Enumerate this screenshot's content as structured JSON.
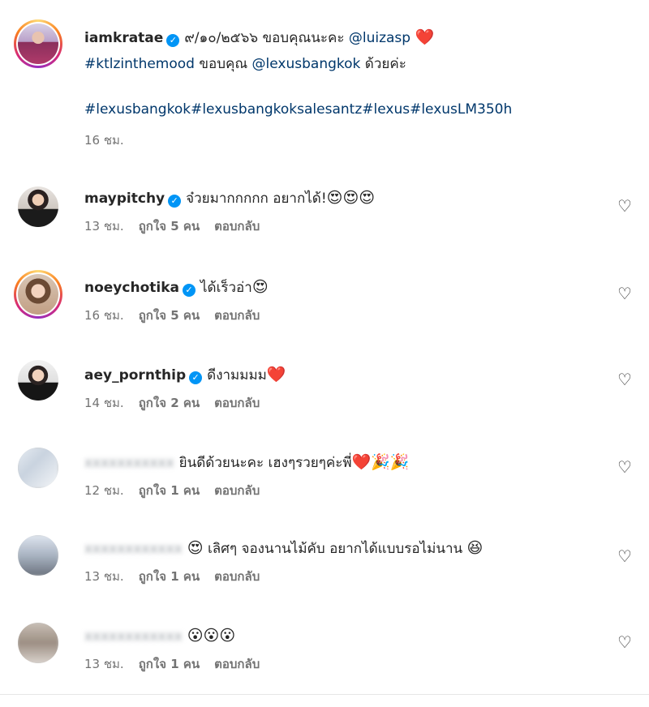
{
  "post": {
    "username": "iamkratae",
    "text_1": "๙/๑๐/๒๕๖๖ ขอบคุณนะคะ ",
    "mention_1": "@luizasp",
    "emoji_1": "❤️",
    "hashtag_1": "#ktlzinthemood",
    "text_2": " ขอบคุณ ",
    "mention_2": "@lexusbangkok",
    "text_3": " ด้วยค่ะ",
    "hashtags": "#lexusbangkok#lexusbangkoksalesantz#lexus#lexusLM350h",
    "time": "16 ชม."
  },
  "comments": [
    {
      "username": "maypitchy",
      "verified": true,
      "text": "จ๋วยมากกกกก อยากได้!",
      "emoji": "😍😍😍",
      "time": "13 ชม.",
      "likes": "ถูกใจ 5 คน",
      "reply": "ตอบกลับ"
    },
    {
      "username": "noeychotika",
      "verified": true,
      "text": "ได้เร็วอ่า",
      "emoji": "😍",
      "time": "16 ชม.",
      "likes": "ถูกใจ 5 คน",
      "reply": "ตอบกลับ"
    },
    {
      "username": "aey_pornthip",
      "verified": true,
      "text": "ดีงามมมม",
      "emoji": "❤️",
      "time": "14 ชม.",
      "likes": "ถูกใจ 2 คน",
      "reply": "ตอบกลับ"
    },
    {
      "username": "",
      "verified": false,
      "text": "ยินดีด้วยนะคะ เฮงๆรวยๆค่ะพี่",
      "emoji": "❤️🎉🎉",
      "time": "12 ชม.",
      "likes": "ถูกใจ 1 คน",
      "reply": "ตอบกลับ"
    },
    {
      "username": "",
      "verified": false,
      "prefix_emoji": "😍",
      "text": " เลิศๆ จองนานไม้คับ อยากได้แบบรอไม่นาน ",
      "emoji": "😆",
      "time": "13 ชม.",
      "likes": "ถูกใจ 1 คน",
      "reply": "ตอบกลับ"
    },
    {
      "username": "",
      "verified": false,
      "text": "",
      "emoji": "😮😮😮",
      "time": "13 ชม.",
      "likes": "ถูกใจ 1 คน",
      "reply": "ตอบกลับ"
    }
  ],
  "icons": {
    "verified": "✓",
    "like_heart": "♡"
  }
}
